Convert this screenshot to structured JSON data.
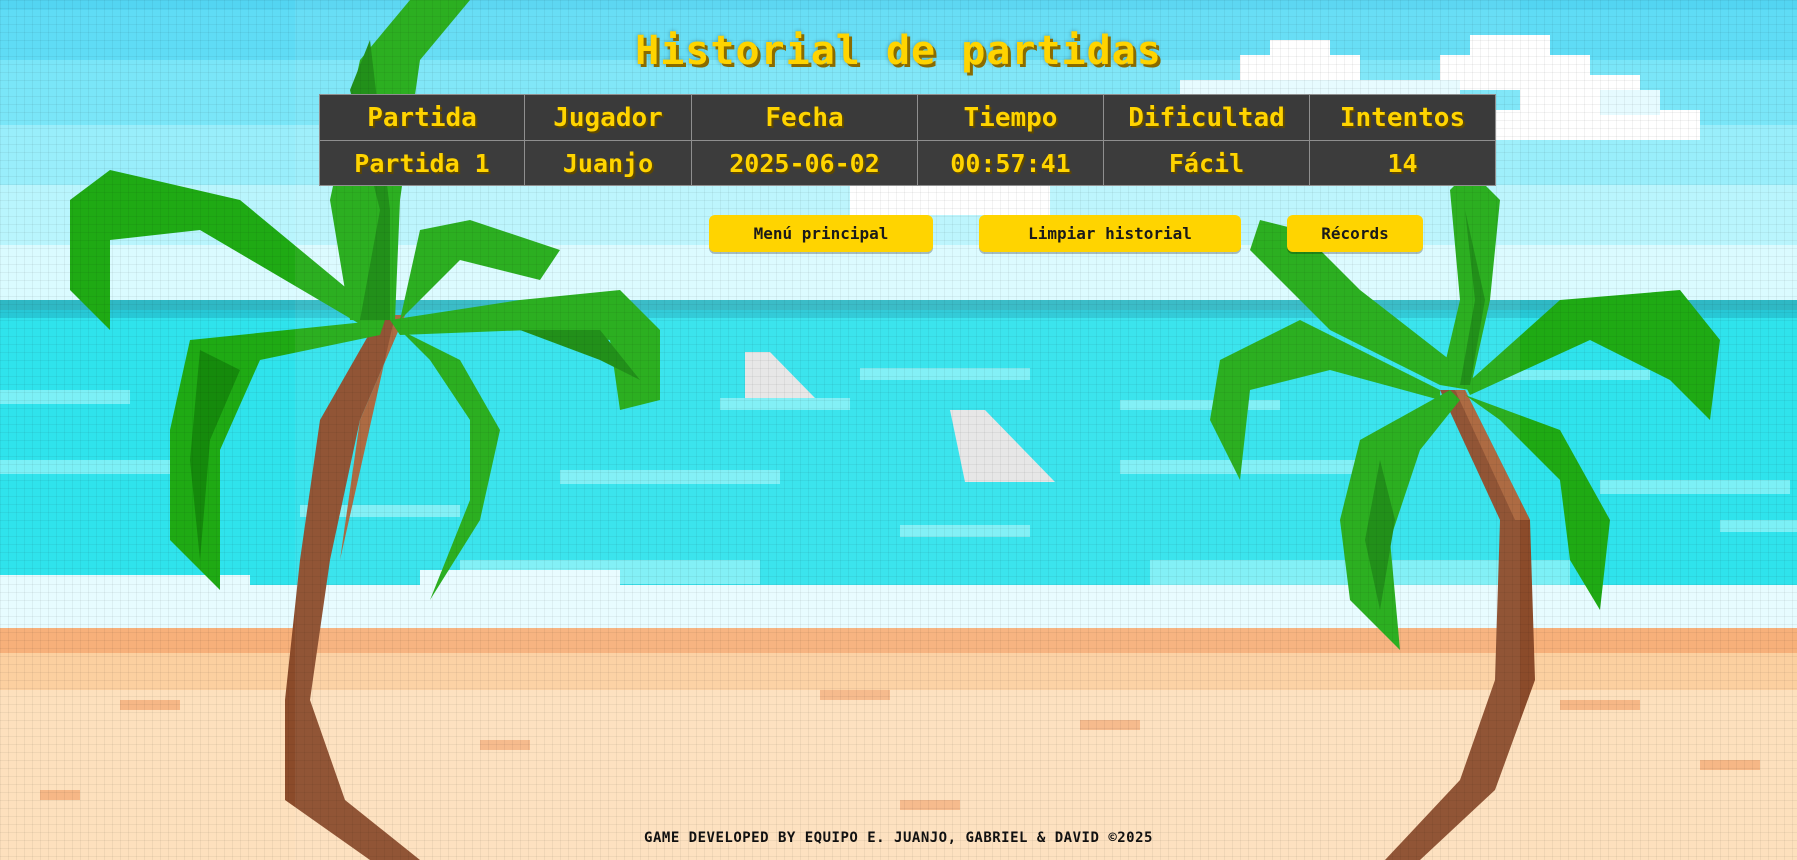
{
  "title": "Historial de partidas",
  "table": {
    "headers": [
      "Partida",
      "Jugador",
      "Fecha",
      "Tiempo",
      "Dificultad",
      "Intentos"
    ],
    "rows": [
      [
        "Partida 1",
        "Juanjo",
        "2025-06-02",
        "00:57:41",
        "Fácil",
        "14"
      ]
    ]
  },
  "buttons": {
    "menu": "Menú principal",
    "clear": "Limpiar historial",
    "records": "Récords"
  },
  "footer": "GAME DEVELOPED BY EQUIPO E. JUANJO, GABRIEL & DAVID ©2025",
  "colors": {
    "accent": "#ffd400",
    "table_bg": "#3a3a3a",
    "sky": "#5fe0f5",
    "sea": "#2fe3ec",
    "sand": "#fcd4a4",
    "palm_leaf": "#1faa14",
    "palm_trunk": "#8b4b2a"
  }
}
